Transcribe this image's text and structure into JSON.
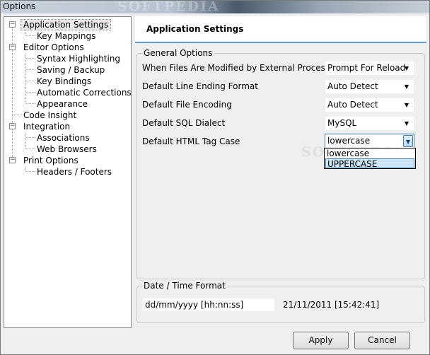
{
  "window": {
    "title": "Options",
    "watermark": "SOFTPEDIA"
  },
  "tree": {
    "items": [
      {
        "label": "Application Settings"
      },
      {
        "label": "Key Mappings"
      },
      {
        "label": "Editor Options"
      },
      {
        "label": "Syntax Highlighting"
      },
      {
        "label": "Saving / Backup"
      },
      {
        "label": "Key Bindings"
      },
      {
        "label": "Automatic Corrections"
      },
      {
        "label": "Appearance"
      },
      {
        "label": "Code Insight"
      },
      {
        "label": "Integration"
      },
      {
        "label": "Associations"
      },
      {
        "label": "Web Browsers"
      },
      {
        "label": "Print Options"
      },
      {
        "label": "Headers / Footers"
      }
    ],
    "expander_symbol": "−"
  },
  "panel": {
    "title": "Application Settings"
  },
  "general": {
    "legend": "General Options",
    "rows": [
      {
        "label": "When Files Are Modified by External Process",
        "value": "Prompt For Reload"
      },
      {
        "label": "Default Line Ending Format",
        "value": "Auto Detect"
      },
      {
        "label": "Default File Encoding",
        "value": "Auto Detect"
      },
      {
        "label": "Default SQL Dialect",
        "value": "MySQL"
      },
      {
        "label": "Default HTML Tag Case",
        "value": "lowercase"
      }
    ],
    "dropdown_options": [
      "lowercase",
      "UPPERCASE"
    ]
  },
  "datetime": {
    "legend": "Date / Time Format",
    "format_value": "dd/mm/yyyy [hh:nn:ss]",
    "preview": "21/11/2011 [15:42:41]"
  },
  "buttons": {
    "apply": "Apply",
    "cancel": "Cancel"
  },
  "colors": {
    "accent": "#5aa0e0",
    "highlight": "#cde4f7",
    "focus_border": "#3b78c8"
  }
}
